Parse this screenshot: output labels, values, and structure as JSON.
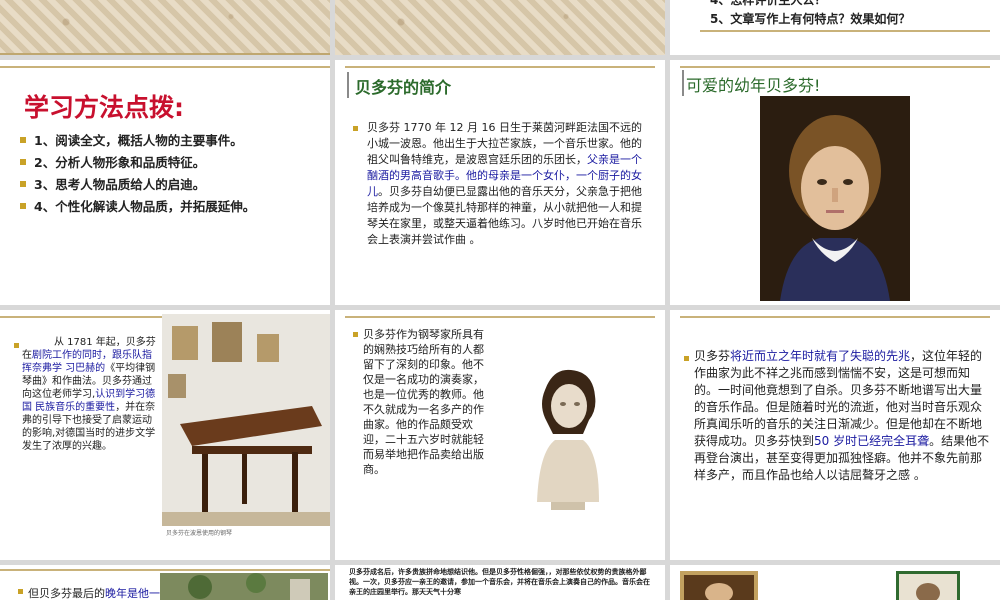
{
  "top_right": {
    "cut_line": "4、怎样评价主人公？",
    "line5": "5、文章写作上有何特点？效果如何？"
  },
  "slide_methods": {
    "title": "学习方法点拨:",
    "items": [
      "1、阅读全文，概括人物的主要事件。",
      "2、分析人物形象和品质特征。",
      "3、思考人物品质给人的启迪。",
      "4、个性化解读人物品质，并拓展延伸。"
    ]
  },
  "slide_intro": {
    "title": "贝多芬的简介",
    "p1": "贝多芬 1770 年 12 月 16 日生于莱茵河畔距法国不远的小城一波恩。他出生于大拉芒家族，一个音乐世家。他的祖父叫鲁特维克，是波恩宫廷乐团的乐团长，",
    "p1_blue": "父亲是一个酗酒的男高音歌手。他的母亲是一个女仆，一个厨子的女儿",
    "p1_end": "。贝多芬自幼便已显露出他的音乐天分，父亲急于把他培养成为一个像莫扎特那样的神童，从小就把他一人和提琴关在家里，或整天逼着他练习。八岁时他已开始在音乐会上表演并尝试作曲 。"
  },
  "slide_child": {
    "title": "可爱的幼年贝多芬!"
  },
  "slide_1781": {
    "a": "从 1781 年起，贝多芬在",
    "a_blue": "剧院工作的同时，跟乐队指挥奈弗学 习巴赫的",
    "b": "《平均律钢琴曲》和作曲法。贝多芬通过向这位老师学习,",
    "b_blue": "认识到学习德国 民族音乐的重要性",
    "c": "，并在奈弗的引导下也接受了启蒙运动的影响,对德国当时的进步文学发生了浓厚的兴趣。",
    "caption": "贝多芬在波恩使用的钢琴"
  },
  "slide_pianist": {
    "text": "贝多芬作为钢琴家所具有的娴熟技巧给所有的人都留下了深刻的印象。他不仅是一名成功的演奏家，也是一位优秀的教师。他不久就成为一名多产的作曲家。他的作品颇受欢迎，二十五六岁时就能轻而易举地把作品卖给出版商。"
  },
  "slide_deaf": {
    "a": "贝多芬",
    "a_blue": "将近而立之年时就有了失聪的先兆",
    "b": "，这位年轻的作曲家为此不祥之兆而感到惴惴不安，这是可想而知的。一时间他竟想到了自杀。贝多芬不断地谱写出大量的音乐作品。但是随着时光的流逝，他对当时音乐观众所真闻乐听的音乐的关注日渐减少。但是他却在不断地获得成功。贝多芬快到",
    "b_blue": "50 岁时已经完全耳聋",
    "c": "。结果他不再登台演出，甚至变得更加孤独怪癖。他并不象先前那样多产，而且作品也给人以诘屈聱牙之感 。"
  },
  "slide_late": {
    "text_a": "但贝多芬最后的",
    "text_blue": "晚年是他一"
  },
  "slide_fame": {
    "text": "贝多芬成名后，许多贵族拼命地想结识他。但是贝多芬性格倔强，，对那些依仗权势的贵族格外鄙视。一次，贝多芬应一亲王的邀请，参加一个音乐会，并将在音乐会上演奏自己的作品。音乐会在亲王的庄园里举行。那天天气十分寒"
  }
}
